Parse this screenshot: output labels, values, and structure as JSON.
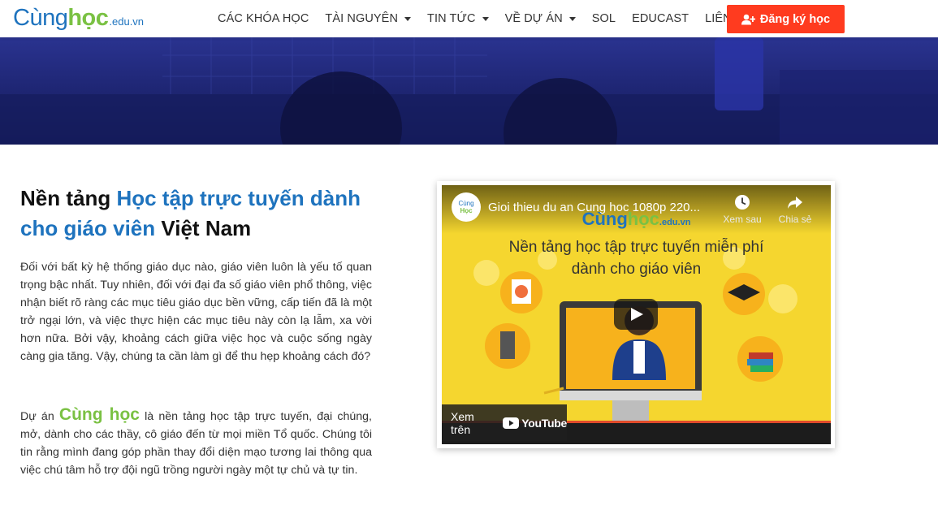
{
  "brand": {
    "logo_part1": "Cùng",
    "logo_part2": "học",
    "logo_suffix": ".edu.vn"
  },
  "nav": {
    "items": [
      {
        "label": "CÁC KHÓA HỌC",
        "dropdown": false
      },
      {
        "label": "TÀI NGUYÊN",
        "dropdown": true
      },
      {
        "label": "TIN TỨC",
        "dropdown": true
      },
      {
        "label": "VỀ DỰ ÁN",
        "dropdown": true
      },
      {
        "label": "SOL",
        "dropdown": false
      },
      {
        "label": "EDUCAST",
        "dropdown": false
      },
      {
        "label": "LIÊN HỆ",
        "dropdown": false
      }
    ],
    "cta_label": "Đăng ký học",
    "cta_icon": "user-plus-icon"
  },
  "content": {
    "headline_part1": "Nền tảng ",
    "headline_highlight": "Học tập trực tuyến dành cho giáo viên",
    "headline_part2": " Việt Nam",
    "paragraph1": "Đối với bất kỳ hệ thống giáo dục nào, giáo viên luôn là yếu tố quan trọng bậc nhất. Tuy nhiên, đối với đại đa số giáo viên phổ thông, việc nhận biết rõ ràng các mục tiêu giáo dục bền vững, cấp tiến đã là một trở ngại lớn, và việc thực hiện các mục tiêu này còn lạ lẫm, xa vời hơn nữa. Bởi vậy, khoảng cách giữa việc học và cuộc sống ngày càng gia tăng. Vậy, chúng ta cần làm gì để thu hẹp khoảng cách đó?",
    "paragraph2_prefix": "Dự án ",
    "paragraph2_brand": "Cùng học",
    "paragraph2_rest": " là nền tảng học tập trực tuyến, đại chúng, mở, dành cho các thầy, cô giáo đến từ mọi miền Tổ quốc. Chúng tôi tin rằng mình đang góp phần thay đổi diện mạo tương lai thông qua việc chú tâm hỗ trợ đội ngũ trồng người ngày một tự chủ và tự tin."
  },
  "video": {
    "channel_avatar_line1": "Cùng",
    "channel_avatar_line2": "Học",
    "title": "Gioi thieu du an Cung hoc 1080p 220...",
    "watch_later_label": "Xem sau",
    "share_label": "Chia sẻ",
    "brand_part1": "Cùng",
    "brand_part2": "học",
    "brand_suffix": ".edu.vn",
    "slide_line1": "Nền tảng học tập trực tuyến miễn phí",
    "slide_line2": "dành cho giáo viên",
    "watch_on_label": "Xem trên",
    "youtube_label": "YouTube"
  },
  "colors": {
    "primary": "#1e73be",
    "accent": "#7ac143",
    "cta": "#ff3b1f",
    "video_bg": "#f5d62f"
  }
}
